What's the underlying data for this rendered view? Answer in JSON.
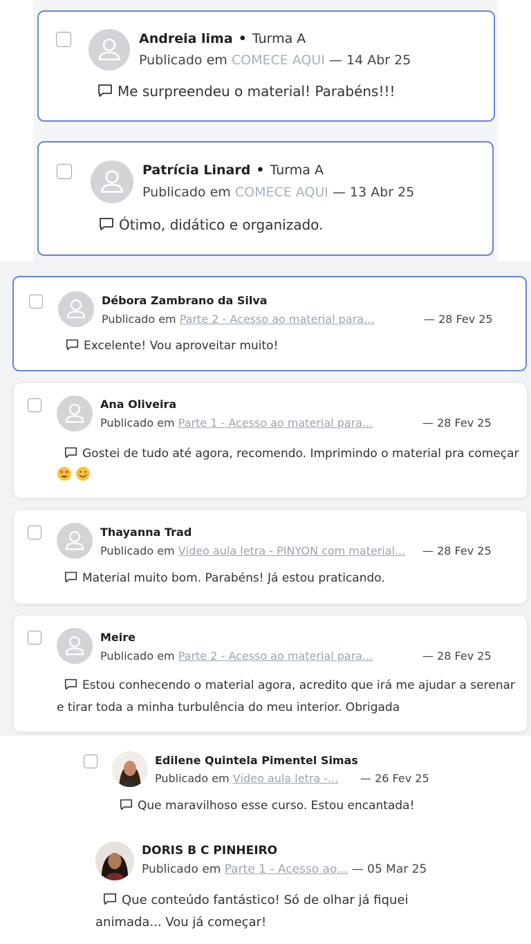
{
  "comments": [
    {
      "name": "Andreia lima",
      "turma": "Turma A",
      "published_prefix": "Publicado em",
      "lesson": "COMECE AQUI",
      "date": "— 14 Abr 25",
      "text": "Me surpreendeu o material! Parabéns!!!"
    },
    {
      "name": "Patrícia Linard",
      "turma": "Turma A",
      "published_prefix": "Publicado em",
      "lesson": "COMECE AQUI",
      "date": "— 13 Abr 25",
      "text": "Ótimo, didático e organizado."
    },
    {
      "name": "Débora Zambrano da Silva",
      "published_prefix": "Publicado em",
      "lesson": "Parte 2 - Acesso ao material para...",
      "date": "— 28 Fev 25",
      "text": "Excelente! Vou aproveitar muito!"
    },
    {
      "name": "Ana Oliveira",
      "published_prefix": "Publicado em",
      "lesson": "Parte 1 - Acesso ao material para...",
      "date": "— 28 Fev 25",
      "text": "Gostei de tudo até agora, recomendo. Imprimindo o material pra começar"
    },
    {
      "name": "Thayanna Trad",
      "published_prefix": "Publicado em",
      "lesson": "Vídeo aula letra - PINYON com material...",
      "date": "— 28 Fev 25",
      "text": "Material muito bom. Parabéns! Já estou praticando."
    },
    {
      "name": "Meire",
      "published_prefix": "Publicado em",
      "lesson": "Parte 2 - Acesso ao material para...",
      "date": "— 28 Fev 25",
      "text": "Estou conhecendo o material agora, acredito que irá me ajudar a serenar e tirar toda a minha turbulência do meu interior. Obrigada"
    },
    {
      "name": "Edilene Quintela Pimentel Simas",
      "published_prefix": "Publicado em",
      "lesson": "Vídeo aula letra -...",
      "date": "— 26 Fev 25",
      "text": "Que maravilhoso esse curso. Estou encantada!"
    },
    {
      "name": "DORIS B C PINHEIRO",
      "published_prefix": "Publicado em",
      "lesson": "Parte 1 - Acesso ao...",
      "date": "— 05 Mar 25",
      "text": "Que conteúdo fantástico! Só de olhar já fiquei animada... Vou já começar!"
    }
  ],
  "icons": {
    "avatar_placeholder": "person-silhouette-icon",
    "comment": "speech-bubble-icon",
    "emoji_1": "heart-eyes-emoji",
    "emoji_2": "smiling-emoji"
  },
  "colors": {
    "selected_border": "#6585d8",
    "link": "#9aa3b6",
    "avatar_bg": "#d2d4d8"
  }
}
